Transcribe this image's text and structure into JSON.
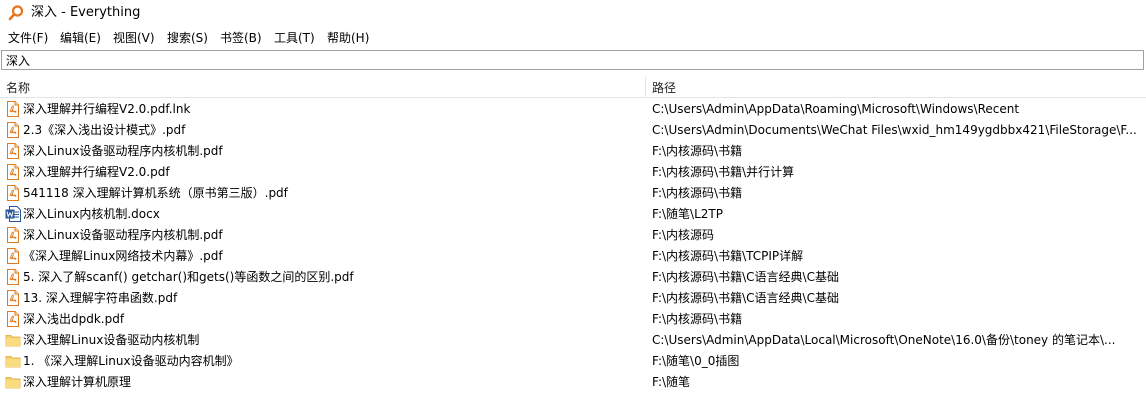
{
  "window": {
    "title": "深入 - Everything"
  },
  "menu": [
    "文件(F)",
    "编辑(E)",
    "视图(V)",
    "搜索(S)",
    "书签(B)",
    "工具(T)",
    "帮助(H)"
  ],
  "search": {
    "value": "深入"
  },
  "columns": {
    "name": "名称",
    "path": "路径"
  },
  "rows": [
    {
      "name": "深入理解并行编程V2.0.pdf.lnk",
      "path": "C:\\Users\\Admin\\AppData\\Roaming\\Microsoft\\Windows\\Recent",
      "icon": "pdf-file-icon"
    },
    {
      "name": "2.3《深入浅出设计模式》.pdf",
      "path": "C:\\Users\\Admin\\Documents\\WeChat Files\\wxid_hm149ygdbbx421\\FileStorage\\F...",
      "icon": "pdf-file-icon"
    },
    {
      "name": "深入Linux设备驱动程序内核机制.pdf",
      "path": "F:\\内核源码\\书籍",
      "icon": "pdf-file-icon"
    },
    {
      "name": "深入理解并行编程V2.0.pdf",
      "path": "F:\\内核源码\\书籍\\并行计算",
      "icon": "pdf-file-icon"
    },
    {
      "name": "541118 深入理解计算机系统（原书第三版）.pdf",
      "path": "F:\\内核源码\\书籍",
      "icon": "pdf-file-icon"
    },
    {
      "name": "深入Linux内核机制.docx",
      "path": "F:\\随笔\\L2TP",
      "icon": "word-file-icon"
    },
    {
      "name": "深入Linux设备驱动程序内核机制.pdf",
      "path": "F:\\内核源码",
      "icon": "pdf-file-icon"
    },
    {
      "name": "《深入理解Linux网络技术内幕》.pdf",
      "path": "F:\\内核源码\\书籍\\TCPIP详解",
      "icon": "pdf-file-icon"
    },
    {
      "name": "5. 深入了解scanf() getchar()和gets()等函数之间的区别.pdf",
      "path": "F:\\内核源码\\书籍\\C语言经典\\C基础",
      "icon": "pdf-file-icon"
    },
    {
      "name": "13. 深入理解字符串函数.pdf",
      "path": "F:\\内核源码\\书籍\\C语言经典\\C基础",
      "icon": "pdf-file-icon"
    },
    {
      "name": "深入浅出dpdk.pdf",
      "path": "F:\\内核源码\\书籍",
      "icon": "pdf-file-icon"
    },
    {
      "name": "深入理解Linux设备驱动内核机制",
      "path": "C:\\Users\\Admin\\AppData\\Local\\Microsoft\\OneNote\\16.0\\备份\\toney 的笔记本\\...",
      "icon": "folder-icon"
    },
    {
      "name": "1. 《深入理解Linux设备驱动内容机制》",
      "path": "F:\\随笔\\0_0插图",
      "icon": "folder-icon"
    },
    {
      "name": "深入理解计算机原理",
      "path": "F:\\随笔",
      "icon": "folder-icon"
    }
  ],
  "colors": {
    "pdf": "#e07a1f",
    "folder": "#f5cf6a",
    "word": "#2b5797",
    "app_icon": "#e8741e"
  }
}
